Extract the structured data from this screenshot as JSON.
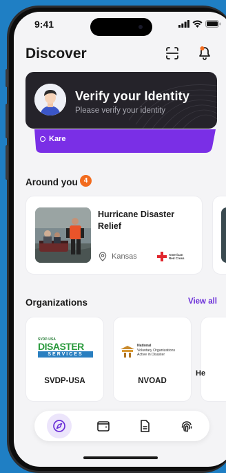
{
  "status_bar": {
    "time": "9:41"
  },
  "header": {
    "title": "Discover"
  },
  "verify_card": {
    "title": "Verify your Identity",
    "subtitle": "Please verify your identity",
    "user_tag": "Kare"
  },
  "around_you": {
    "title": "Around you",
    "badge_count": "4",
    "events": [
      {
        "title": "Hurricane Disaster Relief",
        "location": "Kansas",
        "org_logo_line1": "American",
        "org_logo_line2": "Red Cross"
      }
    ]
  },
  "organizations": {
    "title": "Organizations",
    "view_all": "View all",
    "items": [
      {
        "name": "SVDP-USA",
        "logo_top": "SVDP-USA",
        "logo_main": "DISASTER",
        "logo_sub": "SERVICES"
      },
      {
        "name": "NVOAD",
        "logo_line1": "National",
        "logo_line2": "Voluntary Organizations",
        "logo_line3": "Active in Disaster"
      },
      {
        "name": "He"
      }
    ]
  },
  "colors": {
    "accent": "#6b2fd8",
    "badge": "#f26b1d",
    "card_dark": "#25232a"
  },
  "nav": [
    {
      "icon": "compass-icon",
      "active": true
    },
    {
      "icon": "wallet-icon",
      "active": false
    },
    {
      "icon": "document-icon",
      "active": false
    },
    {
      "icon": "fingerprint-icon",
      "active": false
    }
  ]
}
